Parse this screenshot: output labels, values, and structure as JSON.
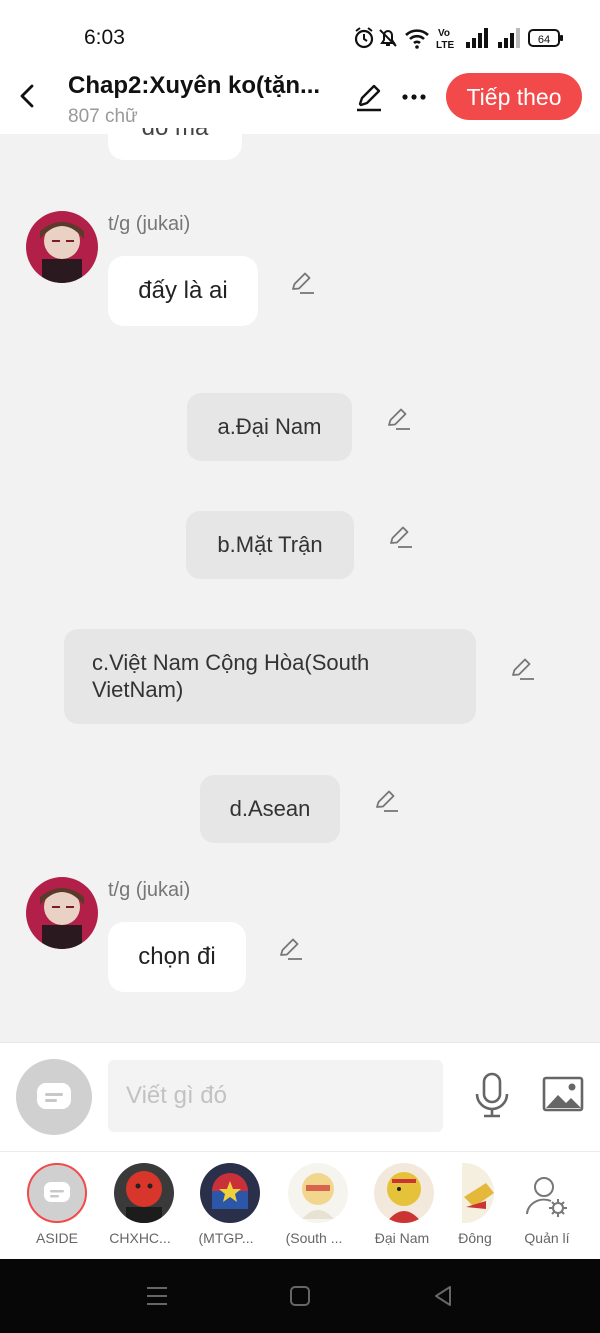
{
  "status_bar": {
    "time": "6:03",
    "battery": "64",
    "volte": "Vo LTE"
  },
  "header": {
    "title": "Chap2:Xuyên ko(tặn...",
    "word_count": "807 chữ",
    "next_label": "Tiếp theo"
  },
  "chat": {
    "top_partial_text": "đó mà",
    "messages": [
      {
        "sender": "t/g (jukai)",
        "text": "đấy là ai"
      },
      {
        "sender": "t/g (jukai)",
        "text": "chọn đi"
      }
    ],
    "choices": [
      "a.Đại Nam",
      "b.Mặt Trận",
      "c.Việt Nam Cộng Hòa(South VietNam)",
      "d.Asean"
    ]
  },
  "composer": {
    "placeholder": "Viết gì đó"
  },
  "characters": [
    {
      "label": "ASIDE"
    },
    {
      "label": "CHXHC..."
    },
    {
      "label": "(MTGP..."
    },
    {
      "label": "(South ..."
    },
    {
      "label": "Đại Nam"
    },
    {
      "label": "Đông"
    },
    {
      "label": "Quản lí"
    }
  ],
  "colors": {
    "accent": "#f24a4a",
    "background": "#f2f2f2",
    "choice_bg": "#e6e6e6"
  }
}
